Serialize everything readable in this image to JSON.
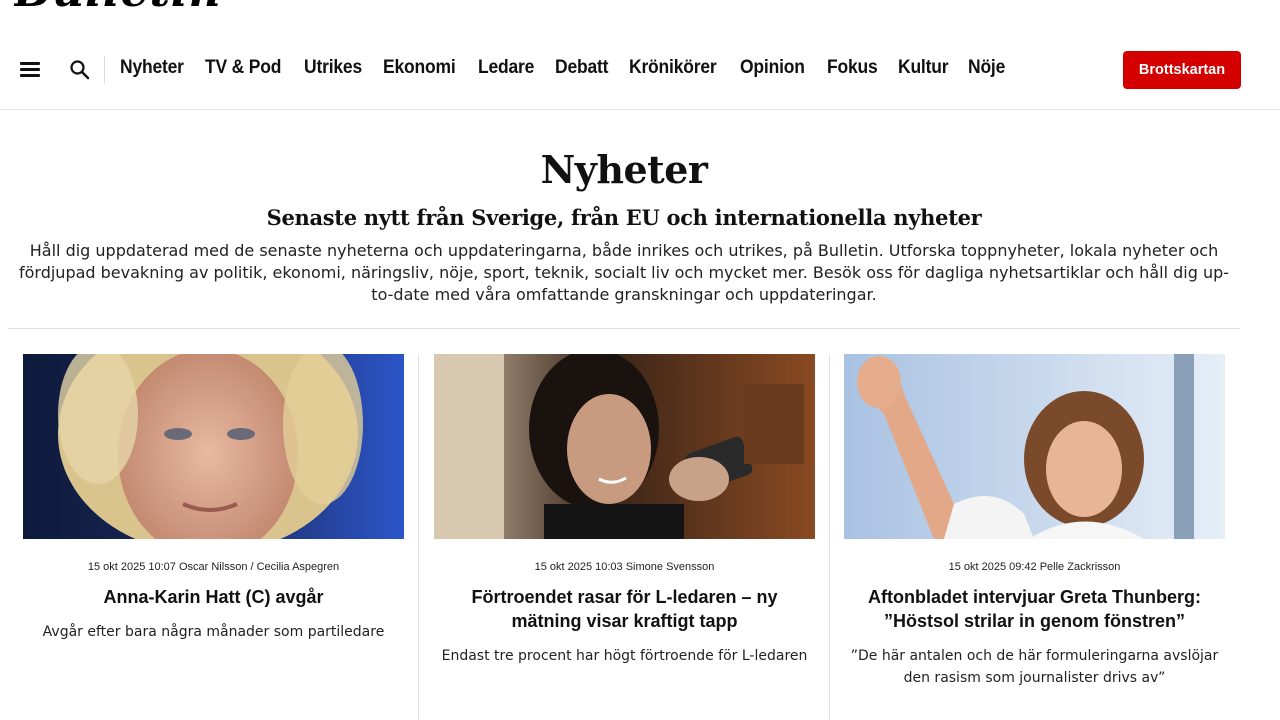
{
  "logo": {
    "text": "Bulletin"
  },
  "nav": {
    "items": [
      {
        "label": "Nyheter",
        "name": "nav-link-nyheter"
      },
      {
        "label": "TV & Pod",
        "name": "nav-link-tv-pod"
      },
      {
        "label": "Utrikes",
        "name": "nav-link-utrikes"
      },
      {
        "label": "Ekonomi",
        "name": "nav-link-ekonomi"
      },
      {
        "label": "Ledare",
        "name": "nav-link-ledare"
      },
      {
        "label": "Debatt",
        "name": "nav-link-debatt"
      },
      {
        "label": "Krönikörer",
        "name": "nav-link-kronikorer"
      },
      {
        "label": "Opinion",
        "name": "nav-link-opinion"
      },
      {
        "label": "Fokus",
        "name": "nav-link-fokus"
      },
      {
        "label": "Kultur",
        "name": "nav-link-kultur"
      },
      {
        "label": "Nöje",
        "name": "nav-link-noje"
      }
    ],
    "cta_label": "Brottskartan",
    "cta_color": "#d40000",
    "menu_icon": "hamburger-menu-icon",
    "search_icon": "search-icon"
  },
  "section": {
    "title": "Nyheter",
    "subtitle": "Senaste nytt från Sverige, från EU och internationella nyheter",
    "description": "Håll dig uppdaterad med de senaste nyheterna och uppdateringarna, både inrikes och utrikes, på Bulletin. Utforska toppnyheter, lokala nyheter och fördjupad bevakning av politik, ekonomi, näringsliv, nöje, sport, teknik, socialt liv och mycket mer. Besök oss för dagliga nyhetsartiklar och håll dig up-to-date med våra omfattande granskningar och uppdateringar."
  },
  "articles": [
    {
      "meta": "15 okt 2025 10:07 Oscar Nilsson / Cecilia Aspegren",
      "title": "Anna-Karin Hatt (C) avgår",
      "lead": "Avgår efter bara några månader som partiledare"
    },
    {
      "meta": "15 okt 2025 10:03 Simone Svensson",
      "title": "Förtroendet rasar för L-ledaren – ny mätning visar kraftigt tapp",
      "lead": "Endast tre procent har högt förtroende för L-ledaren"
    },
    {
      "meta": "15 okt 2025 09:42 Pelle Zackrisson",
      "title": "Aftonbladet intervjuar Greta Thunberg: ”Höstsol strilar in genom fönstren”",
      "lead": "”De här antalen och de här formuleringarna avslöjar den rasism som journalister drivs av”"
    }
  ]
}
